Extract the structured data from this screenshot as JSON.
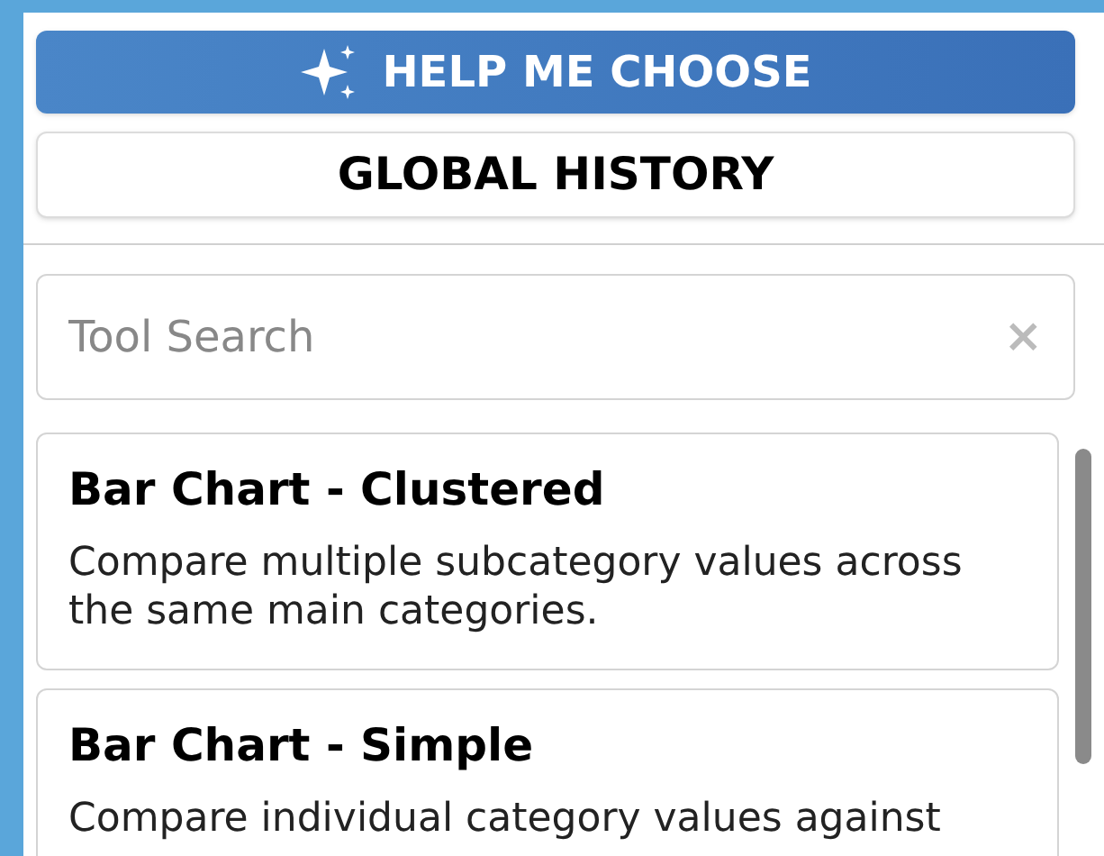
{
  "help_button": {
    "label": "HELP ME CHOOSE"
  },
  "history_button": {
    "label": "GLOBAL HISTORY"
  },
  "search": {
    "placeholder": "Tool Search",
    "clear": "×"
  },
  "tools": [
    {
      "title": "Bar Chart - Clustered",
      "description": "Compare multiple subcategory values across the same main categories."
    },
    {
      "title": "Bar Chart - Simple",
      "description": "Compare individual category values against"
    }
  ]
}
